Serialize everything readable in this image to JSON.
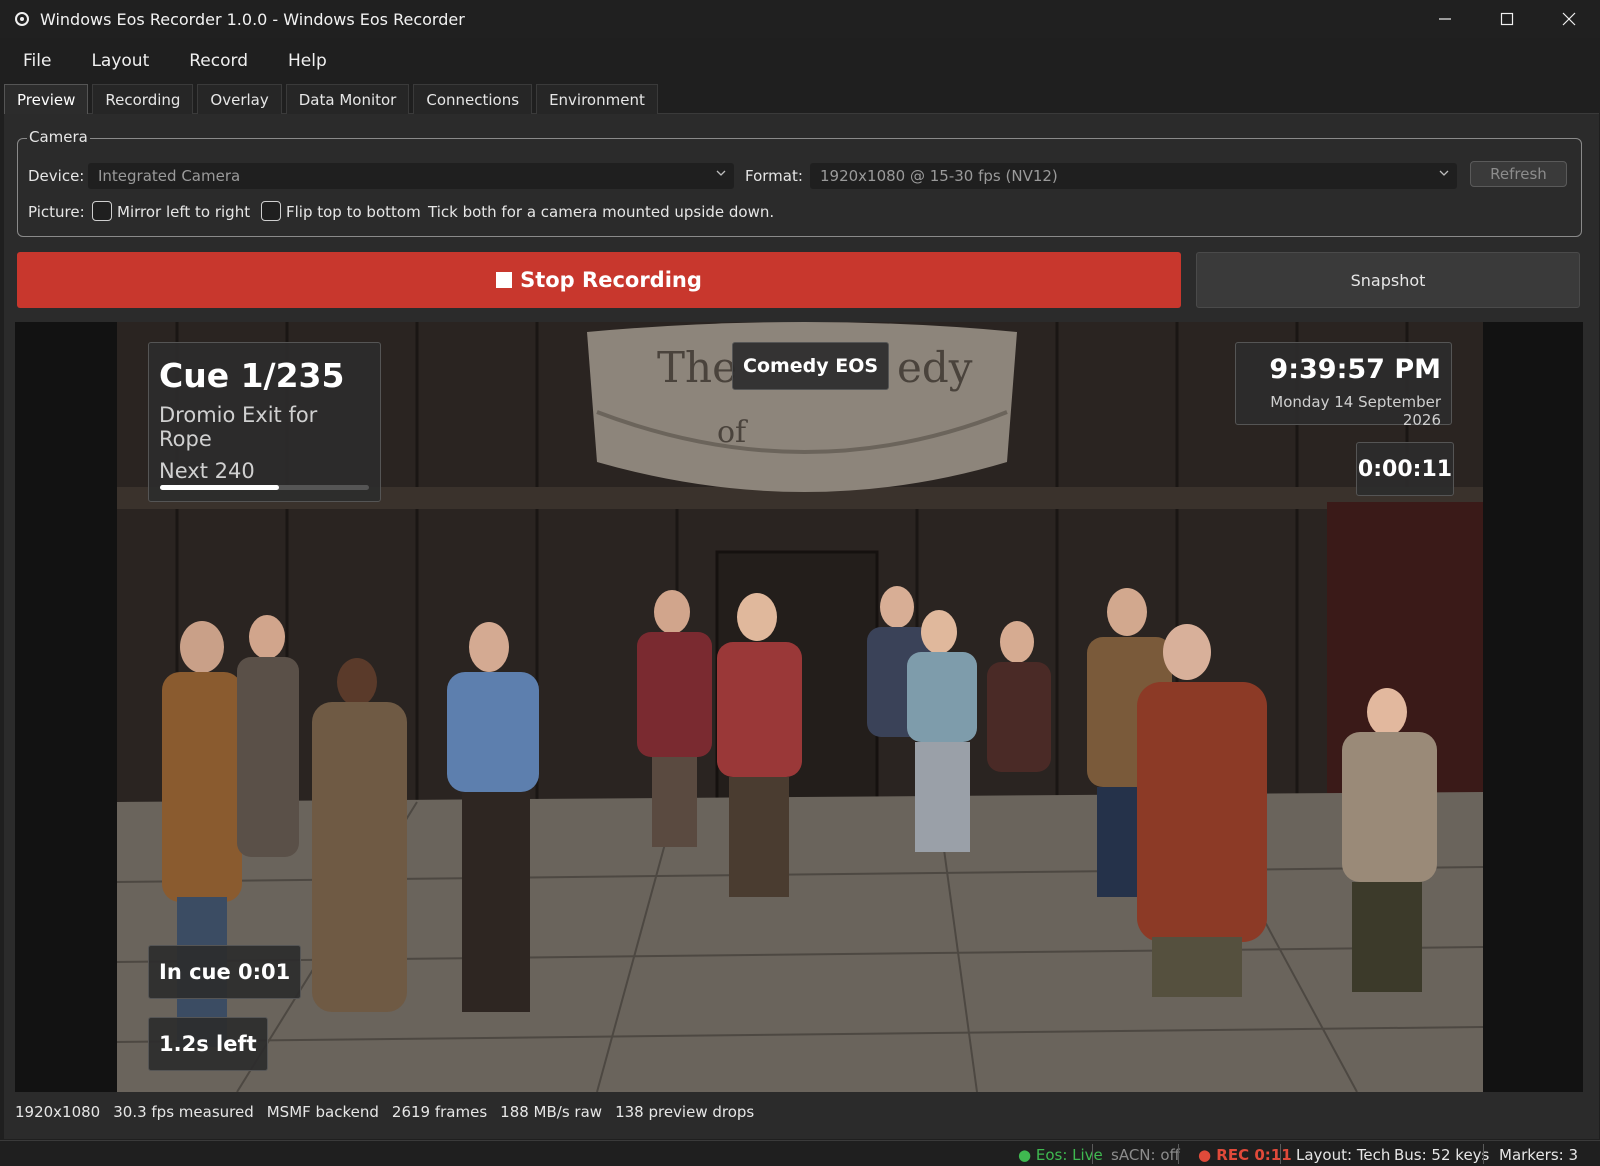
{
  "window": {
    "title": "Windows Eos Recorder 1.0.0 - Windows Eos Recorder",
    "minimize": "—",
    "maximize": "☐",
    "close": "✕"
  },
  "menu": [
    "File",
    "Layout",
    "Record",
    "Help"
  ],
  "tabs": [
    "Preview",
    "Recording",
    "Overlay",
    "Data Monitor",
    "Connections",
    "Environment"
  ],
  "active_tab": "Preview",
  "camera": {
    "group_title": "Camera",
    "device_label": "Device:",
    "device_value": "Integrated Camera",
    "format_label": "Format:",
    "format_value": "1920x1080 @ 15-30 fps (NV12)",
    "refresh_label": "Refresh",
    "picture_label": "Picture:",
    "mirror_label": "Mirror left to right",
    "mirror_checked": false,
    "flip_label": "Flip top to bottom",
    "flip_checked": false,
    "hint": "Tick both for a camera mounted upside down."
  },
  "actions": {
    "stop_label": "Stop Recording",
    "snapshot_label": "Snapshot"
  },
  "overlay": {
    "cue": "Cue 1/235",
    "cue_label": "Dromio Exit for Rope",
    "next": "Next  240",
    "cue_progress": 0.57,
    "show_name": "Comedy EOS",
    "time": "9:39:57 PM",
    "date": "Monday 14 September 2026",
    "elapsed": "0:00:11",
    "in_cue": "In cue 0:01",
    "left": "1.2s left"
  },
  "stats": [
    "1920x1080",
    "30.3 fps measured",
    "MSMF backend",
    "2619 frames",
    "188 MB/s raw",
    "138 preview drops"
  ],
  "status": {
    "eos": "● Eos: Live",
    "sacn": "sACN: off",
    "rec": "● REC 0:11",
    "layout": "Layout: Tech",
    "bus": "Bus: 52 keys",
    "markers": "Markers: 3"
  },
  "colors": {
    "accent_red": "#c8372d",
    "live_green": "#3fb950",
    "rec_red": "#e04a3a",
    "muted": "#8c8c8c"
  }
}
